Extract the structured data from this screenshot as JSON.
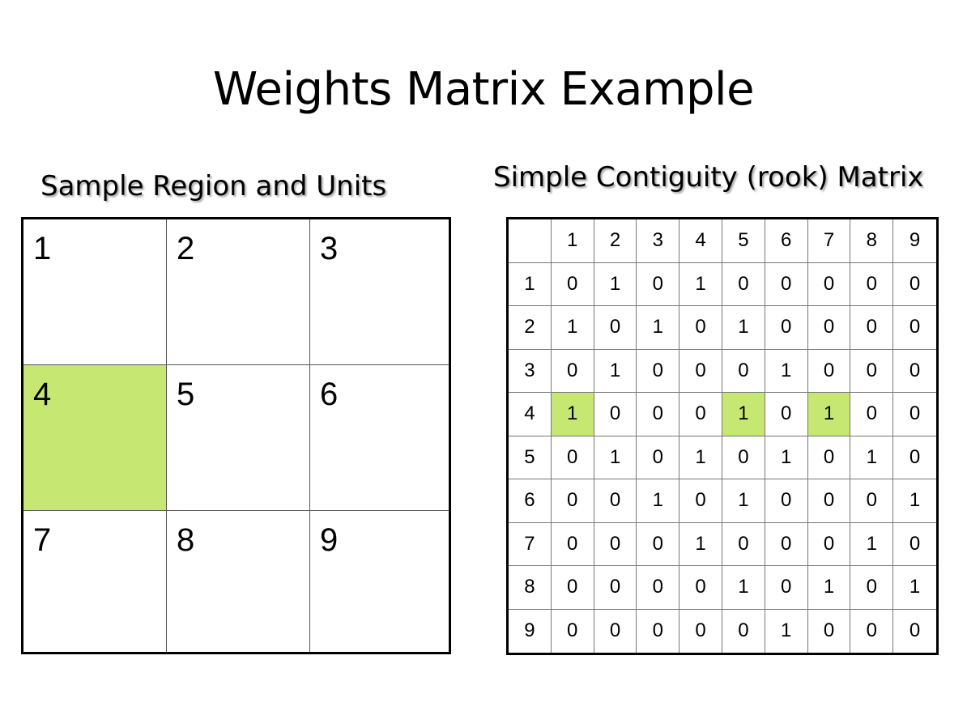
{
  "title": "Weights Matrix Example",
  "left_panel": {
    "subtitle": "Sample Region and Units",
    "units": [
      "1",
      "2",
      "3",
      "4",
      "5",
      "6",
      "7",
      "8",
      "9"
    ],
    "highlighted_unit": "4"
  },
  "right_panel": {
    "subtitle": "Simple Contiguity (rook) Matrix",
    "column_headers": [
      "",
      "1",
      "2",
      "3",
      "4",
      "5",
      "6",
      "7",
      "8",
      "9"
    ],
    "rows": [
      {
        "label": "1",
        "values": [
          "0",
          "1",
          "0",
          "1",
          "0",
          "0",
          "0",
          "0",
          "0"
        ]
      },
      {
        "label": "2",
        "values": [
          "1",
          "0",
          "1",
          "0",
          "1",
          "0",
          "0",
          "0",
          "0"
        ]
      },
      {
        "label": "3",
        "values": [
          "0",
          "1",
          "0",
          "0",
          "0",
          "1",
          "0",
          "0",
          "0"
        ]
      },
      {
        "label": "4",
        "values": [
          "1",
          "0",
          "0",
          "0",
          "1",
          "0",
          "1",
          "0",
          "0"
        ]
      },
      {
        "label": "5",
        "values": [
          "0",
          "1",
          "0",
          "1",
          "0",
          "1",
          "0",
          "1",
          "0"
        ]
      },
      {
        "label": "6",
        "values": [
          "0",
          "0",
          "1",
          "0",
          "1",
          "0",
          "0",
          "0",
          "1"
        ]
      },
      {
        "label": "7",
        "values": [
          "0",
          "0",
          "0",
          "1",
          "0",
          "0",
          "0",
          "1",
          "0"
        ]
      },
      {
        "label": "8",
        "values": [
          "0",
          "0",
          "0",
          "0",
          "1",
          "0",
          "1",
          "0",
          "1"
        ]
      },
      {
        "label": "9",
        "values": [
          "0",
          "0",
          "0",
          "0",
          "0",
          "1",
          "0",
          "0",
          "0"
        ]
      }
    ],
    "highlighted_row": "4",
    "highlighted_columns": [
      "1",
      "5",
      "7"
    ]
  },
  "colors": {
    "highlight": "#c6e872",
    "background": "#ffffff"
  }
}
